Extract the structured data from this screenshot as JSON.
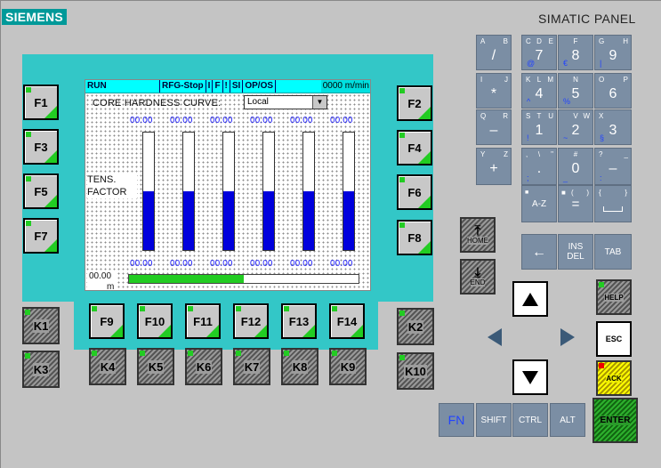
{
  "brand": "SIEMENS",
  "panel_title": "SIMATIC PANEL",
  "screen": {
    "status": [
      "RUN",
      "RFG-Stop",
      "I",
      "F",
      "!",
      "SI",
      "OP/OS"
    ],
    "speed": "0000 m/min",
    "curve_label": "CORE HARDNESS CURVE:",
    "combo_value": "Local",
    "top_values": [
      "00.00",
      "00.00",
      "00.00",
      "00.00",
      "00.00",
      "00.00"
    ],
    "bottom_values": [
      "00.00",
      "00.00",
      "00.00",
      "00.00",
      "00.00",
      "00.00"
    ],
    "tens_label": "TENS.",
    "factor_label": "FACTOR",
    "bar_levels": [
      0.5,
      0.5,
      0.5,
      0.5,
      0.5,
      0.5
    ],
    "bottom_value": "00.00",
    "bottom_unit": "m",
    "progress": 0.5
  },
  "fkeys_left": [
    "F1",
    "F3",
    "F5",
    "F7"
  ],
  "fkeys_right": [
    "F2",
    "F4",
    "F6",
    "F8"
  ],
  "fkeys_bottom": [
    "F9",
    "F10",
    "F11",
    "F12",
    "F13",
    "F14"
  ],
  "kkeys": {
    "k1": "K1",
    "k3": "K3",
    "k2": "K2",
    "k10": "K10",
    "bottom": [
      "K4",
      "K5",
      "K6",
      "K7",
      "K8",
      "K9"
    ]
  },
  "keypad": [
    {
      "tl": "A",
      "tr": "B",
      "big": "/",
      "bl": ""
    },
    {
      "tl": "C",
      "tm": "D",
      "tr": "E",
      "big": "7",
      "bl": "@"
    },
    {
      "tl": "",
      "tm": "F",
      "tr": "",
      "big": "8",
      "bl": "€"
    },
    {
      "tl": "G",
      "tr": "H",
      "big": "9",
      "bl": "|"
    },
    {
      "tl": "I",
      "tr": "J",
      "big": "*",
      "bl": ""
    },
    {
      "tl": "K",
      "tm": "L",
      "tr": "M",
      "big": "4",
      "bl": "^"
    },
    {
      "tl": "",
      "tm": "N",
      "tr": "",
      "big": "5",
      "bl": "%"
    },
    {
      "tl": "O",
      "tr": "P",
      "big": "6",
      "bl": ""
    },
    {
      "tl": "Q",
      "tr": "R",
      "big": "–",
      "bl": ""
    },
    {
      "tl": "S",
      "tm": "T",
      "tr": "U",
      "big": "1",
      "bl": "!"
    },
    {
      "tl": "",
      "tm": "V",
      "tr": "W",
      "big": "2",
      "bl": "~"
    },
    {
      "tl": "X",
      "tr": "",
      "big": "3",
      "bl": "§"
    },
    {
      "tl": "Y",
      "tr": "Z",
      "big": "+",
      "bl": ""
    },
    {
      "tl": ",",
      "tm": "\\",
      "tr": "\"",
      "big": ".",
      "bl": ";"
    },
    {
      "tl": "",
      "tm": "#",
      "tr": "",
      "big": "0",
      "bl": "_"
    },
    {
      "tl": "?",
      "tr": "_",
      "big": "–",
      "bl": ":"
    }
  ],
  "keys": {
    "az": "A-Z",
    "eq": "=",
    "space": "",
    "home": "HOME",
    "end": "END",
    "back": "←",
    "ins": "INS",
    "del": "DEL",
    "tab": "TAB",
    "help": "HELP",
    "esc": "ESC",
    "ack": "ACK",
    "enter": "ENTER",
    "fn": "FN",
    "shift": "SHIFT",
    "ctrl": "CTRL",
    "alt": "ALT",
    "paren_l": "(",
    "paren_r": ")",
    "brace_l": "{",
    "brace_r": "}"
  },
  "colors": {
    "teal": "#33c7c7",
    "brand": "#009999",
    "status_bar": "#00ffff",
    "bar_fill": "#0000dd",
    "progress": "#22cc22",
    "keypad": "#7b8ea4",
    "ack": "#ffee00",
    "enter": "#22aa22"
  }
}
